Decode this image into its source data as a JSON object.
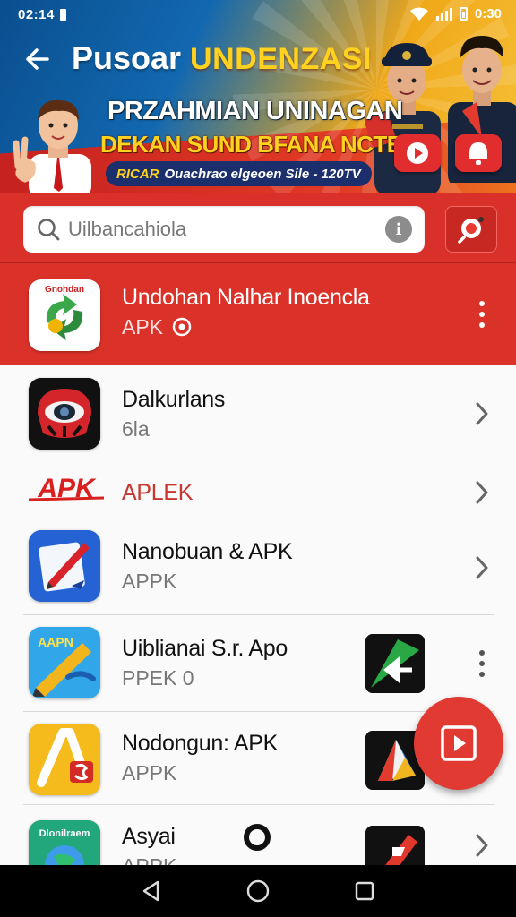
{
  "status_bar": {
    "time": "02:14",
    "right_text": "0:30"
  },
  "header": {
    "title": "Pusoar",
    "title_accent": "UNDENZASI",
    "banner_line1": "PRZAHMIAN UNINAGAN",
    "banner_line2": "DEKAN SUND BFANA NCTERN",
    "banner_pill_tag": "RICAR",
    "banner_pill_text": "Ouachrao elgeoen Sile - 120TV"
  },
  "search": {
    "placeholder": "Uilbancahiola"
  },
  "featured": {
    "title": "Undohan Nalhar Inoencla",
    "subtitle": "APK",
    "icon_label": "Gnohdan"
  },
  "apps": [
    {
      "title": "Dalkurlans",
      "subtitle": "6la"
    },
    {
      "title": "APLEK",
      "subtitle": "",
      "logo_text": "APK"
    },
    {
      "title": "Nanobuan & APK",
      "subtitle": "APPK"
    },
    {
      "title": "Uiblianai S.r. Apo",
      "subtitle": "PPEK 0",
      "icon_label": "AAPN"
    },
    {
      "title": "Nodongun: APK",
      "subtitle": "APPK"
    },
    {
      "title": "Asyai",
      "subtitle": "APPK",
      "icon_label": "Dlonilraem"
    }
  ],
  "colors": {
    "primary_red": "#d9302a",
    "banner_yellow": "#ffd21f",
    "banner_blue": "#1268b0"
  },
  "icons": {
    "back": "arrow-left-icon",
    "search": "magnifier-icon",
    "info": "info-icon",
    "voice": "camera-search-icon",
    "fab": "play-square-icon",
    "nav": [
      "back-triangle-icon",
      "home-circle-icon",
      "recents-square-icon"
    ]
  }
}
